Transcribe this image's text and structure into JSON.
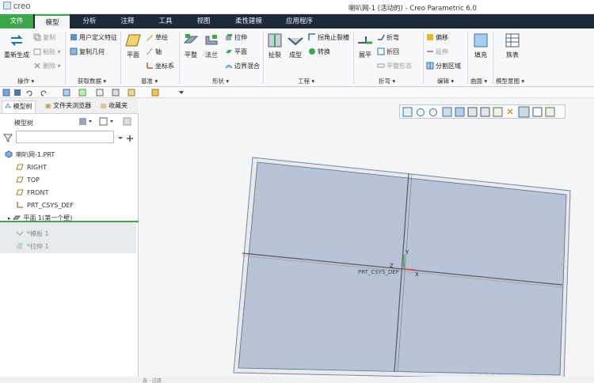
{
  "app": {
    "logo_text": "creo",
    "window_title": "喇叭网-1 (活动的) - Creo Parametric 6.0"
  },
  "tabs": [
    "文件",
    "模型",
    "分析",
    "注释",
    "工具",
    "视图",
    "柔性建模",
    "应用程序"
  ],
  "active_tab": "模型",
  "ribbon": {
    "groups": [
      {
        "label": "操作 ▾",
        "items": [
          "重新生成",
          "复制",
          "粘贴 ▾",
          "删除 ▾"
        ]
      },
      {
        "label": "获取数据 ▾",
        "items": [
          "用户定义特征",
          "复制几何"
        ]
      },
      {
        "label": "基准 ▾",
        "items": [
          "平面",
          "草绘",
          "轴",
          "坐标系"
        ]
      },
      {
        "label": "形状 ▾",
        "items": [
          "平整",
          "法兰",
          "拉伸",
          "平面",
          "边界混合"
        ]
      },
      {
        "label": "工程 ▾",
        "items": [
          "扯裂",
          "成型",
          "拐角止裂槽",
          "转换"
        ]
      },
      {
        "label": "折弯 ▾",
        "items": [
          "展平",
          "折弯",
          "折回",
          "平整形态"
        ]
      },
      {
        "label": "编辑 ▾",
        "items": [
          "偏移",
          "延伸",
          "分割区域"
        ]
      },
      {
        "label": "曲面 ▾",
        "items": [
          "填充"
        ]
      },
      {
        "label": "模型意图 ▾",
        "items": [
          "族表"
        ]
      }
    ]
  },
  "left_panel": {
    "tabs": [
      "模型树",
      "文件夹浏览器",
      "收藏夹"
    ],
    "header": "模型树",
    "search_placeholder": "",
    "tree": [
      {
        "label": "喇叭网-1.PRT",
        "icon": "part-icon"
      },
      {
        "label": "RIGHT",
        "icon": "datum-plane-icon"
      },
      {
        "label": "TOP",
        "icon": "datum-plane-icon"
      },
      {
        "label": "FRONT",
        "icon": "datum-plane-icon"
      },
      {
        "label": "PRT_CSYS_DEF",
        "icon": "csys-icon"
      },
      {
        "label": "平面 1(第一个壁)",
        "icon": "wall-icon"
      },
      {
        "label": "*模板 1",
        "icon": "form-icon"
      },
      {
        "label": "*拉伸 1",
        "icon": "extrude-icon"
      }
    ]
  },
  "viewport": {
    "csys_label": "PRT_CSYS_DEF",
    "axis_x": "X",
    "axis_y": "Y",
    "axis_z": "Z",
    "sheet_color": "#b8c4d6",
    "status_text": "选 · 过滤"
  },
  "colors": {
    "accent_green": "#3aa84a",
    "tabbar": "#1f2a38",
    "x_axis": "#e14b4b",
    "y_axis": "#3aa84a"
  }
}
